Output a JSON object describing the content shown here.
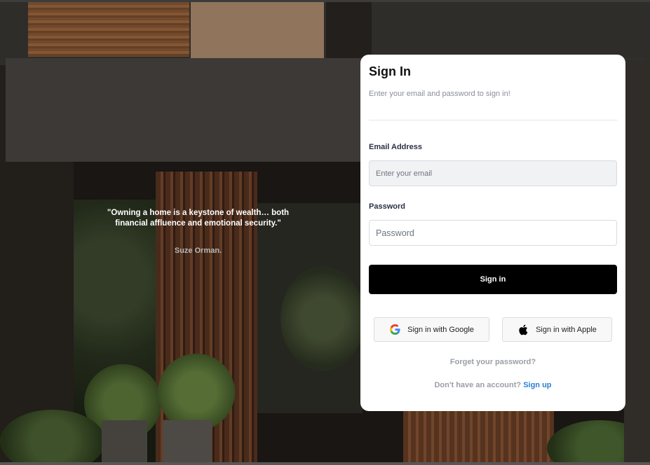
{
  "hero": {
    "quote": "\"Owning a home is a keystone of wealth… both financial affluence and emotional security.\"",
    "author": "Suze Orman."
  },
  "card": {
    "title": "Sign In",
    "subtitle": "Enter your email and password to sign in!",
    "email": {
      "label": "Email Address",
      "placeholder": "Enter your email",
      "value": ""
    },
    "password": {
      "label": "Password",
      "placeholder": "Password",
      "value": ""
    },
    "submit_label": "Sign in",
    "google_label": "Sign in with Google",
    "google_icon": "google-icon",
    "apple_label": "Sign in with Apple",
    "apple_icon": "apple-icon",
    "forgot_label": "Forget your password?",
    "signup_prompt": "Don't have an account?",
    "signup_link": "Sign up"
  },
  "colors": {
    "primary_button": "#000000",
    "link": "#2a7fd4",
    "muted_text": "#9a9ea6"
  }
}
